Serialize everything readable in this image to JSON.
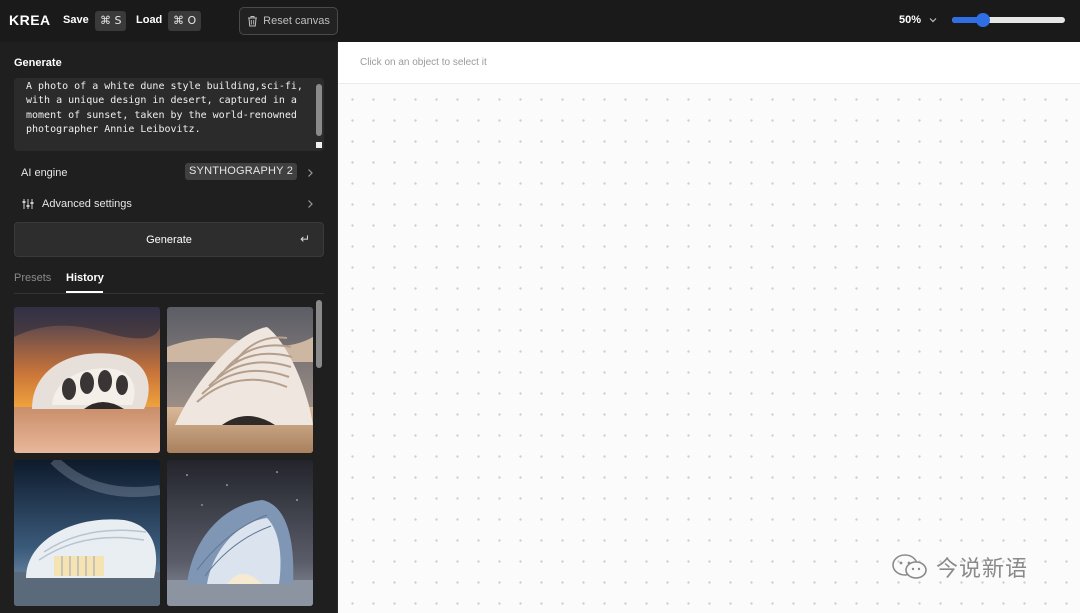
{
  "topbar": {
    "logo": "KREA",
    "save_label": "Save",
    "save_shortcut": "⌘ S",
    "load_label": "Load",
    "load_shortcut": "⌘ O",
    "reset_label": "Reset canvas",
    "zoom_label": "50%",
    "zoom_slider_value": 0.24,
    "accent_color": "#2f6ee5"
  },
  "sidebar": {
    "generate_title": "Generate",
    "prompt": "A photo of a white dune style building,sci-fi, with a unique design in desert, captured in a moment of sunset, taken by the world-renowned photographer Annie Leibovitz.",
    "ai_engine_label": "AI engine",
    "ai_engine_value": "SYNTHOGRAPHY 2",
    "advanced_label": "Advanced settings",
    "generate_button": "Generate",
    "generate_key": "↵",
    "tabs": [
      {
        "label": "Presets",
        "active": false
      },
      {
        "label": "History",
        "active": true
      }
    ],
    "history": [
      {
        "name": "history-image-sunset-building"
      },
      {
        "name": "history-image-dune-building"
      },
      {
        "name": "history-image-night-building"
      },
      {
        "name": "history-image-blue-building"
      }
    ]
  },
  "canvas": {
    "hint": "Click on an object to select it"
  },
  "watermark": {
    "text": "今说新语"
  }
}
